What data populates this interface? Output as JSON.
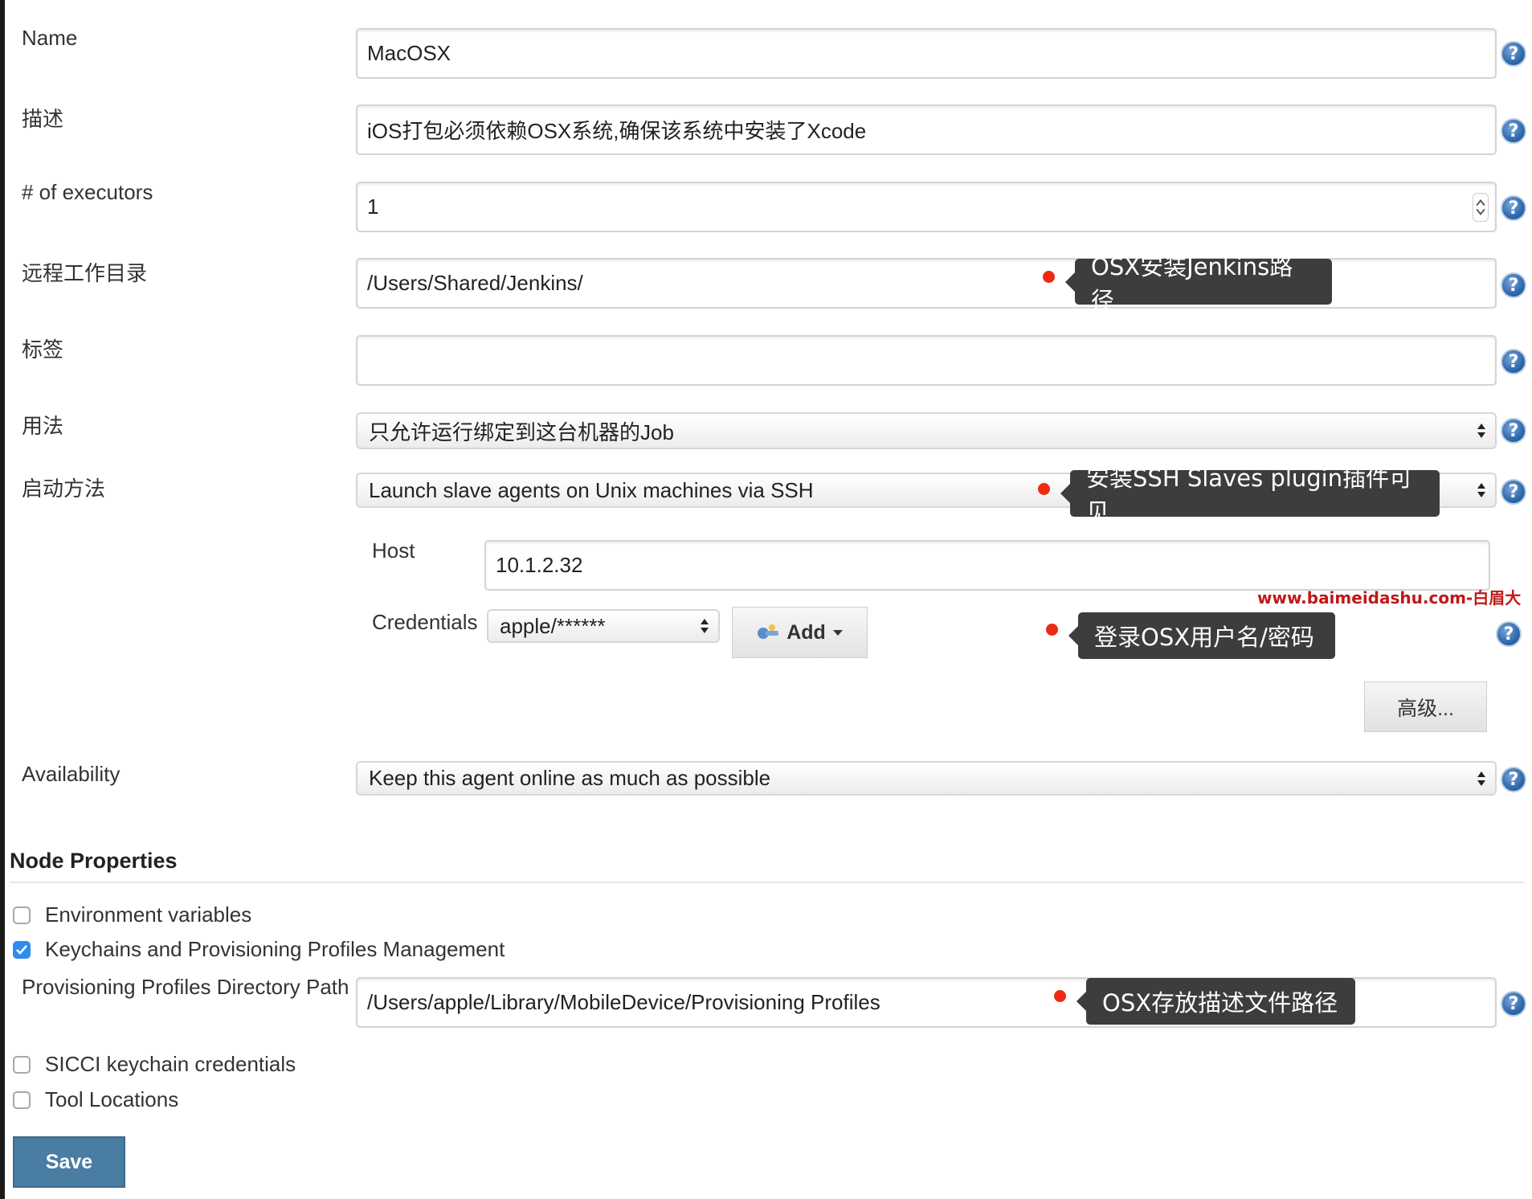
{
  "form": {
    "name": {
      "label": "Name",
      "value": "MacOSX"
    },
    "description": {
      "label": "描述",
      "value": "iOS打包必须依赖OSX系统,确保该系统中安装了Xcode"
    },
    "executors": {
      "label": "# of executors",
      "value": "1"
    },
    "remote_dir": {
      "label": "远程工作目录",
      "value": "/Users/Shared/Jenkins/"
    },
    "tags": {
      "label": "标签",
      "value": ""
    },
    "usage": {
      "label": "用法",
      "selected": "只允许运行绑定到这台机器的Job"
    },
    "launch_method": {
      "label": "启动方法",
      "selected": "Launch slave agents on Unix machines via SSH"
    },
    "host": {
      "label": "Host",
      "value": "10.1.2.32"
    },
    "credentials": {
      "label": "Credentials",
      "selected": "apple/******",
      "add_label": "Add"
    },
    "advanced_label": "高级...",
    "availability": {
      "label": "Availability",
      "selected": "Keep this agent online as much as possible"
    }
  },
  "node_properties": {
    "title": "Node Properties",
    "env_vars": {
      "label": "Environment variables",
      "checked": false
    },
    "keychains": {
      "label": "Keychains and Provisioning Profiles Management",
      "checked": true
    },
    "prov_path": {
      "label": "Provisioning Profiles Directory Path",
      "value": "/Users/apple/Library/MobileDevice/Provisioning Profiles"
    },
    "sicci": {
      "label": "SICCI keychain credentials",
      "checked": false
    },
    "tool_locations": {
      "label": "Tool Locations",
      "checked": false
    }
  },
  "annotations": {
    "jenkins_path": "OSX安装Jenkins路径",
    "ssh_plugin": "安装SSH Slaves plugin插件可见",
    "login": "登录OSX用户名/密码",
    "profiles_path": "OSX存放描述文件路径"
  },
  "watermark": "www.baimeidashu.com-白眉大叔",
  "save_label": "Save",
  "help_glyph": "?",
  "colors": {
    "save_button": "#4a7da2",
    "annotation_dot": "#ee2a12",
    "annotation_bubble": "#3d3d3d",
    "help_icon": "#2f68ad",
    "checkbox_checked": "#2d8cf0",
    "watermark": "#c01818"
  }
}
